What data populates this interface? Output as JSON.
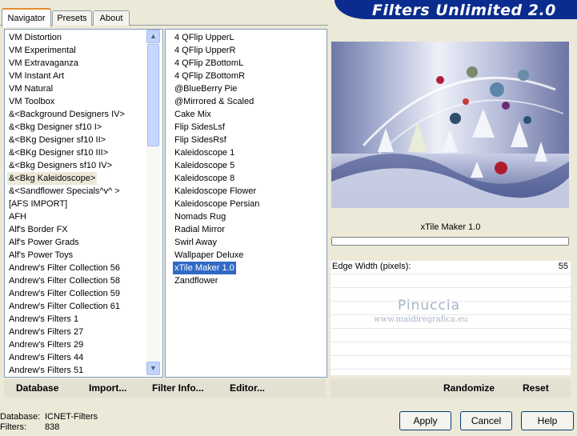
{
  "app": {
    "banner_title": "Filters Unlimited 2.0"
  },
  "tabs": [
    {
      "label": "Navigator",
      "active": true
    },
    {
      "label": "Presets",
      "active": false
    },
    {
      "label": "About",
      "active": false
    }
  ],
  "categories": {
    "selected": "&<Bkg Kaleidoscope>",
    "items": [
      "VM Distortion",
      "VM Experimental",
      "VM Extravaganza",
      "VM Instant Art",
      "VM Natural",
      "VM Toolbox",
      "&<Background Designers IV>",
      "&<Bkg Designer sf10 I>",
      "&<BKg Designer sf10 II>",
      "&<BKg Designer sf10 III>",
      "&<Bkg Designers sf10 IV>",
      "&<Bkg Kaleidoscope>",
      "&<Sandflower Specials^v^ >",
      "[AFS IMPORT]",
      "AFH",
      "Alf's Border FX",
      "Alf's Power Grads",
      "Alf's Power Toys",
      "Andrew's Filter Collection 56",
      "Andrew's Filter Collection 58",
      "Andrew's Filter Collection 59",
      "Andrew's Filter Collection 61",
      "Andrew's Filters 1",
      "Andrew's Filters 27",
      "Andrew's Filters 29",
      "Andrew's Filters 44",
      "Andrew's Filters 51"
    ]
  },
  "filters": {
    "selected": "xTile Maker 1.0",
    "items": [
      "4 QFlip UpperL",
      "4 QFlip UpperR",
      "4 QFlip ZBottomL",
      "4 QFlip ZBottomR",
      "@BlueBerry Pie",
      "@Mirrored & Scaled",
      "Cake Mix",
      "Flip SidesLsf",
      "Flip SidesRsf",
      "Kaleidoscope 1",
      "Kaleidoscope 5",
      "Kaleidoscope 8",
      "Kaleidoscope Flower",
      "Kaleidoscope Persian",
      "Nomads Rug",
      "Radial Mirror",
      "Swirl Away",
      "Wallpaper Deluxe",
      "xTile Maker 1.0",
      "Zandflower"
    ]
  },
  "toolbar": {
    "database": "Database",
    "import": "Import...",
    "filter_info": "Filter Info...",
    "editor": "Editor...",
    "randomize": "Randomize",
    "reset": "Reset"
  },
  "preview": {
    "filter_name": "xTile Maker 1.0",
    "watermark_name": "Pinuccia",
    "watermark_url": "www.maidiregrafica.eu"
  },
  "parameters": [
    {
      "label": "Edge Width (pixels):",
      "value": "55"
    }
  ],
  "status": {
    "database_label": "Database:",
    "database_value": "ICNET-Filters",
    "filters_label": "Filters:",
    "filters_value": "838"
  },
  "buttons": {
    "apply": "Apply",
    "cancel": "Cancel",
    "help": "Help"
  },
  "colors": {
    "selection": "#316ac5",
    "banner": "#0a2c8f",
    "dialog_bg": "#ece9d8"
  }
}
